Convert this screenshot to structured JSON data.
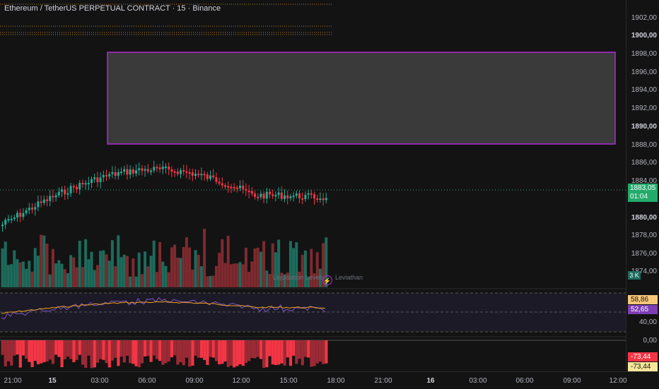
{
  "header": {
    "title": "Ethereum / TetherUS PERPETUAL CONTRACT · 15 · Binance"
  },
  "price_axis": {
    "ticks": [
      "1902,00",
      "1900,00",
      "1898,00",
      "1896,00",
      "1894,00",
      "1892,00",
      "1890,00",
      "1888,00",
      "1886,00",
      "1884,00",
      "1880,00",
      "1878,00",
      "1876,00",
      "1874,00"
    ],
    "bold_ticks": [
      "1900,00",
      "1890,00",
      "1880,00"
    ]
  },
  "current_price": {
    "value": "1883,05",
    "countdown": "01:04",
    "color": "#22ab6b"
  },
  "volume_badge": "3 K",
  "oscillator_axis": {
    "badge1": "58,86",
    "badge2": "52,65",
    "tick": "40,00"
  },
  "lower_axis": {
    "tick": "0,00",
    "badge1": "-73,44",
    "badge2": "-73,44"
  },
  "time_axis": {
    "labels": [
      "21:00",
      "15",
      "03:00",
      "06:00",
      "09:00",
      "12:00",
      "15:00",
      "18:00",
      "21:00",
      "16",
      "03:00",
      "06:00",
      "09:00",
      "12:00"
    ],
    "bold_labels": [
      "15",
      "16"
    ]
  },
  "watermark": {
    "liquidation": "Liquidation Levels",
    "brand": "Leviathan"
  },
  "colors": {
    "up": "#22ab94",
    "down": "#f23645",
    "zone_border": "#b02bd6",
    "osc_line": "#7e57c2",
    "osc_avg": "#f7a21b"
  }
}
